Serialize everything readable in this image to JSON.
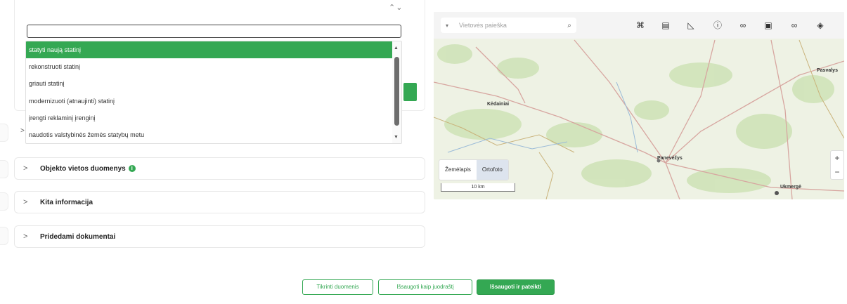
{
  "form": {
    "dropdown": {
      "search_value": "",
      "options": [
        "statyti naują statinį",
        "rekonstruoti statinį",
        "griauti statinį",
        "modernizuoti (atnaujinti) statinį",
        "įrengti reklaminį įrenginį",
        "naudotis valstybinės žemės statybų metu"
      ],
      "selected_index": 0
    },
    "sections": [
      {
        "title": "Objekto vietos duomenys",
        "has_info": true,
        "info_glyph": "i"
      },
      {
        "title": "Kita informacija",
        "has_info": false
      },
      {
        "title": "Pridedami dokumentai",
        "has_info": false
      }
    ]
  },
  "map": {
    "search_placeholder": "Vietovės paieška",
    "tools": [
      "measure-icon",
      "document-icon",
      "area-icon",
      "info-icon",
      "link-icon",
      "export-icon",
      "chain-icon",
      "layers-icon"
    ],
    "basemap_tabs": [
      "Žemėlapis",
      "Ortofoto"
    ],
    "active_basemap": 1,
    "scale_text": "10 km",
    "labels": [
      {
        "name": "Kėdainiai"
      },
      {
        "name": "Panevėžys"
      },
      {
        "name": "Pasvalys"
      },
      {
        "name": "Ukmergė"
      }
    ]
  },
  "actions": {
    "check_data": "Tikrinti duomenis",
    "save_draft": "Išsaugoti kaip juodraštį",
    "save_submit": "Išsaugoti ir pateikti"
  },
  "colors": {
    "accent": "#34a853"
  }
}
